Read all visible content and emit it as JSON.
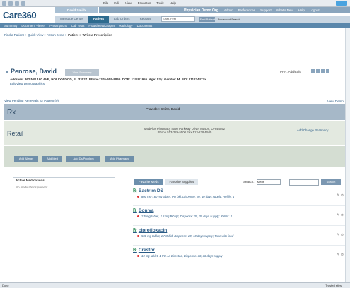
{
  "toolbar": {
    "menu": [
      "File",
      "Edit",
      "View",
      "Favorites",
      "Tools",
      "Help"
    ]
  },
  "header": {
    "logo": "Care360",
    "logo_sub": "TM/Pwr Online",
    "user": "David Smith",
    "practice": "Physician Demo Org",
    "links": [
      "Admin",
      "Preferences",
      "Support",
      "What's New",
      "Help",
      "Logout"
    ],
    "nav": [
      "Message Center",
      "Patient",
      "Lab Orders",
      "Reports"
    ],
    "search_placeholder": "Last, First",
    "find_label": "Find Patient",
    "adv_label": "Advanced Search",
    "subnav": [
      "Summary",
      "Document Viewer",
      "Prescriptions",
      "Lab Tests",
      "Flowsheets/Graphs",
      "Radiology",
      "Documents"
    ]
  },
  "breadcrumb": {
    "l1": "Find a Patient",
    "l2": "Quick View",
    "l3": "Action Items",
    "rest": "Patient :: Write a Prescription"
  },
  "patient": {
    "name": "Penrose, David",
    "view_summary": "View Summary",
    "address": "Address: 362 NW 160 AVE, HOLLYWOOD, FL 33027",
    "phone": "Phone: 305-555-8866",
    "dob": "DOB: 12/18/1955",
    "age": "Age: 53y",
    "gender": "Gender: M",
    "pid": "PID: 111224477x",
    "edit": "Edit/View Demographics",
    "phr": "PHR: Add/Edit"
  },
  "pending": "View Pending Renewals for Patient (0)",
  "view_demo": "View Demo",
  "rx": {
    "title": "Rx",
    "provider": "Provider: Smith, David"
  },
  "retail": {
    "label": "Retail",
    "address": "MedPlus Pharmacy 4050 Parkway Drive, Mason, OH 44052",
    "phone": "Phone 513-229-5500 Fax 513-229-5505",
    "change": "Add/Change Pharmacy"
  },
  "action_buttons": [
    "Add Allergy",
    "Add Med",
    "Add Dx/Problem",
    "Add Pharmacy"
  ],
  "active_meds": {
    "title": "Active Medications",
    "none": "No medications present"
  },
  "tabs": [
    "Favorite Meds",
    "Favorite Supplies"
  ],
  "search": {
    "label": "Search:",
    "select": "Meds",
    "button": "Search"
  },
  "meds": [
    {
      "name": "Bactrim DS",
      "sig": "800 mg-160 mg tablet, PO bid, Dispense: 20, 10 days supply; Refills: 1"
    },
    {
      "name": "Boniva",
      "sig": "2.5 mg tablet, 2.5 mg PO qd, Dispense: 30, 30 days supply; Refills: 3"
    },
    {
      "name": "ciprofloxacin",
      "sig": "500 mg tablet, 1 PO bid, Dispense: 20, 10 days supply; Take with food"
    },
    {
      "name": "Crestor",
      "sig": "10 mg tablet, 1 PO As Directed, Dispense: 30, 30 days supply"
    }
  ],
  "status": {
    "left": "Done",
    "right": "Trusted sites"
  }
}
